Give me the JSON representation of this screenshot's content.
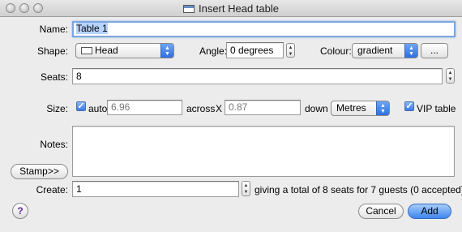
{
  "window": {
    "title": "Insert Head table"
  },
  "name": {
    "label": "Name:",
    "value": "Table 1"
  },
  "shape": {
    "label": "Shape:",
    "value": "Head"
  },
  "angle": {
    "label": "Angle:",
    "value": "0 degrees"
  },
  "colour": {
    "label": "Colour:",
    "value": "gradient",
    "more_label": "..."
  },
  "seats": {
    "label": "Seats:",
    "value": "8"
  },
  "size": {
    "label": "Size:",
    "auto_label": "auto",
    "auto_checked": true,
    "width": "6.96",
    "across_label": "across",
    "x_label": "X",
    "depth": "0.87",
    "down_label": "down",
    "unit": "Metres",
    "vip_label": "VIP table",
    "vip_checked": true
  },
  "notes": {
    "label": "Notes:",
    "value": ""
  },
  "stamp": {
    "label": "Stamp>>"
  },
  "create": {
    "label": "Create:",
    "value": "1",
    "summary": "giving a total of 8 seats for 7 guests (0 accepted)"
  },
  "buttons": {
    "help": "?",
    "cancel": "Cancel",
    "add": "Add"
  }
}
